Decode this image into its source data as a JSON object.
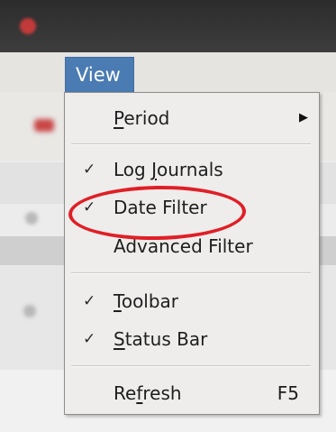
{
  "menu": {
    "title": "View",
    "items": [
      {
        "label_pre": "",
        "mnemonic": "P",
        "label_post": "eriod",
        "checked": false,
        "submenu": true,
        "shortcut": ""
      },
      {
        "label_pre": "Log ",
        "mnemonic": "J",
        "label_post": "ournals",
        "checked": true,
        "submenu": false,
        "shortcut": ""
      },
      {
        "label_pre": "Date Filter",
        "mnemonic": "",
        "label_post": "",
        "checked": true,
        "submenu": false,
        "shortcut": ""
      },
      {
        "label_pre": "Advanced Filter",
        "mnemonic": "",
        "label_post": "",
        "checked": false,
        "submenu": false,
        "shortcut": ""
      },
      {
        "label_pre": "",
        "mnemonic": "T",
        "label_post": "oolbar",
        "checked": true,
        "submenu": false,
        "shortcut": ""
      },
      {
        "label_pre": "",
        "mnemonic": "S",
        "label_post": "tatus Bar",
        "checked": true,
        "submenu": false,
        "shortcut": ""
      },
      {
        "label_pre": "Re",
        "mnemonic": "f",
        "label_post": "resh",
        "checked": false,
        "submenu": false,
        "shortcut": "F5"
      }
    ],
    "check_glyph": "✓",
    "submenu_glyph": "▶"
  },
  "colors": {
    "menu_header": "#4a7bb3",
    "menu_bg": "#eeedec",
    "annotation": "#e01f26"
  }
}
